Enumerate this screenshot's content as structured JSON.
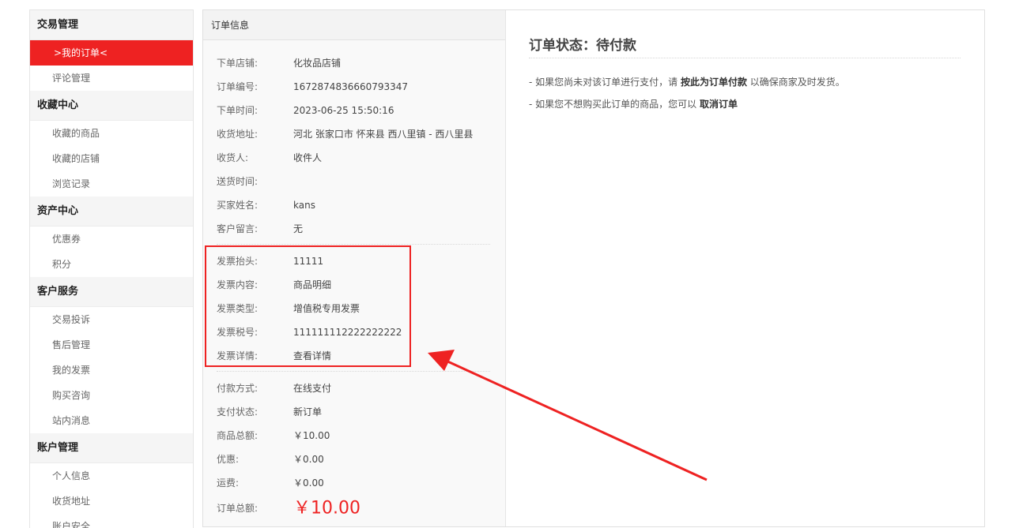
{
  "sidebar": {
    "groups": [
      {
        "title": "交易管理",
        "items": [
          {
            "label": ">我的订单<",
            "active": true
          },
          {
            "label": "评论管理"
          }
        ]
      },
      {
        "title": "收藏中心",
        "items": [
          {
            "label": "收藏的商品"
          },
          {
            "label": "收藏的店铺"
          },
          {
            "label": "浏览记录"
          }
        ]
      },
      {
        "title": "资产中心",
        "items": [
          {
            "label": "优惠券"
          },
          {
            "label": "积分"
          }
        ]
      },
      {
        "title": "客户服务",
        "items": [
          {
            "label": "交易投诉"
          },
          {
            "label": "售后管理"
          },
          {
            "label": "我的发票"
          },
          {
            "label": "购买咨询"
          },
          {
            "label": "站内消息"
          }
        ]
      },
      {
        "title": "账户管理",
        "items": [
          {
            "label": "个人信息"
          },
          {
            "label": "收货地址"
          },
          {
            "label": "账户安全"
          }
        ]
      }
    ]
  },
  "order_panel": {
    "title": "订单信息",
    "basic": [
      {
        "label": "下单店铺:",
        "value": "化妆品店铺"
      },
      {
        "label": "订单编号:",
        "value": "1672874836660793347"
      },
      {
        "label": "下单时间:",
        "value": "2023-06-25 15:50:16"
      },
      {
        "label": "收货地址:",
        "value": "河北 张家口市 怀来县 西八里镇 - 西八里县"
      },
      {
        "label": "收货人:",
        "value": "收件人"
      },
      {
        "label": "送货时间:",
        "value": ""
      },
      {
        "label": "买家姓名:",
        "value": "kans"
      },
      {
        "label": "客户留言:",
        "value": "无"
      }
    ],
    "invoice": [
      {
        "label": "发票抬头:",
        "value": "11111"
      },
      {
        "label": "发票内容:",
        "value": "商品明细"
      },
      {
        "label": "发票类型:",
        "value": "增值税专用发票"
      },
      {
        "label": "发票税号:",
        "value": "111111112222222222"
      },
      {
        "label": "发票详情:",
        "value": "查看详情"
      }
    ],
    "payment": [
      {
        "label": "付款方式:",
        "value": "在线支付"
      },
      {
        "label": "支付状态:",
        "value": "新订单"
      },
      {
        "label": "商品总额:",
        "value": "￥10.00"
      },
      {
        "label": "优惠:",
        "value": "￥0.00"
      },
      {
        "label": "运费:",
        "value": "￥0.00"
      },
      {
        "label": "订单总额:",
        "value": "￥10.00"
      }
    ]
  },
  "status": {
    "title": "订单状态：待付款",
    "tip1_prefix": "- 如果您尚未对该订单进行支付，请 ",
    "tip1_link": "按此为订单付款",
    "tip1_suffix": " 以确保商家及时发货。",
    "tip2_prefix": "- 如果您不想购买此订单的商品，您可以 ",
    "tip2_link": "取消订单"
  },
  "colors": {
    "accent": "#ee2222",
    "annotation": "#ee2222"
  }
}
